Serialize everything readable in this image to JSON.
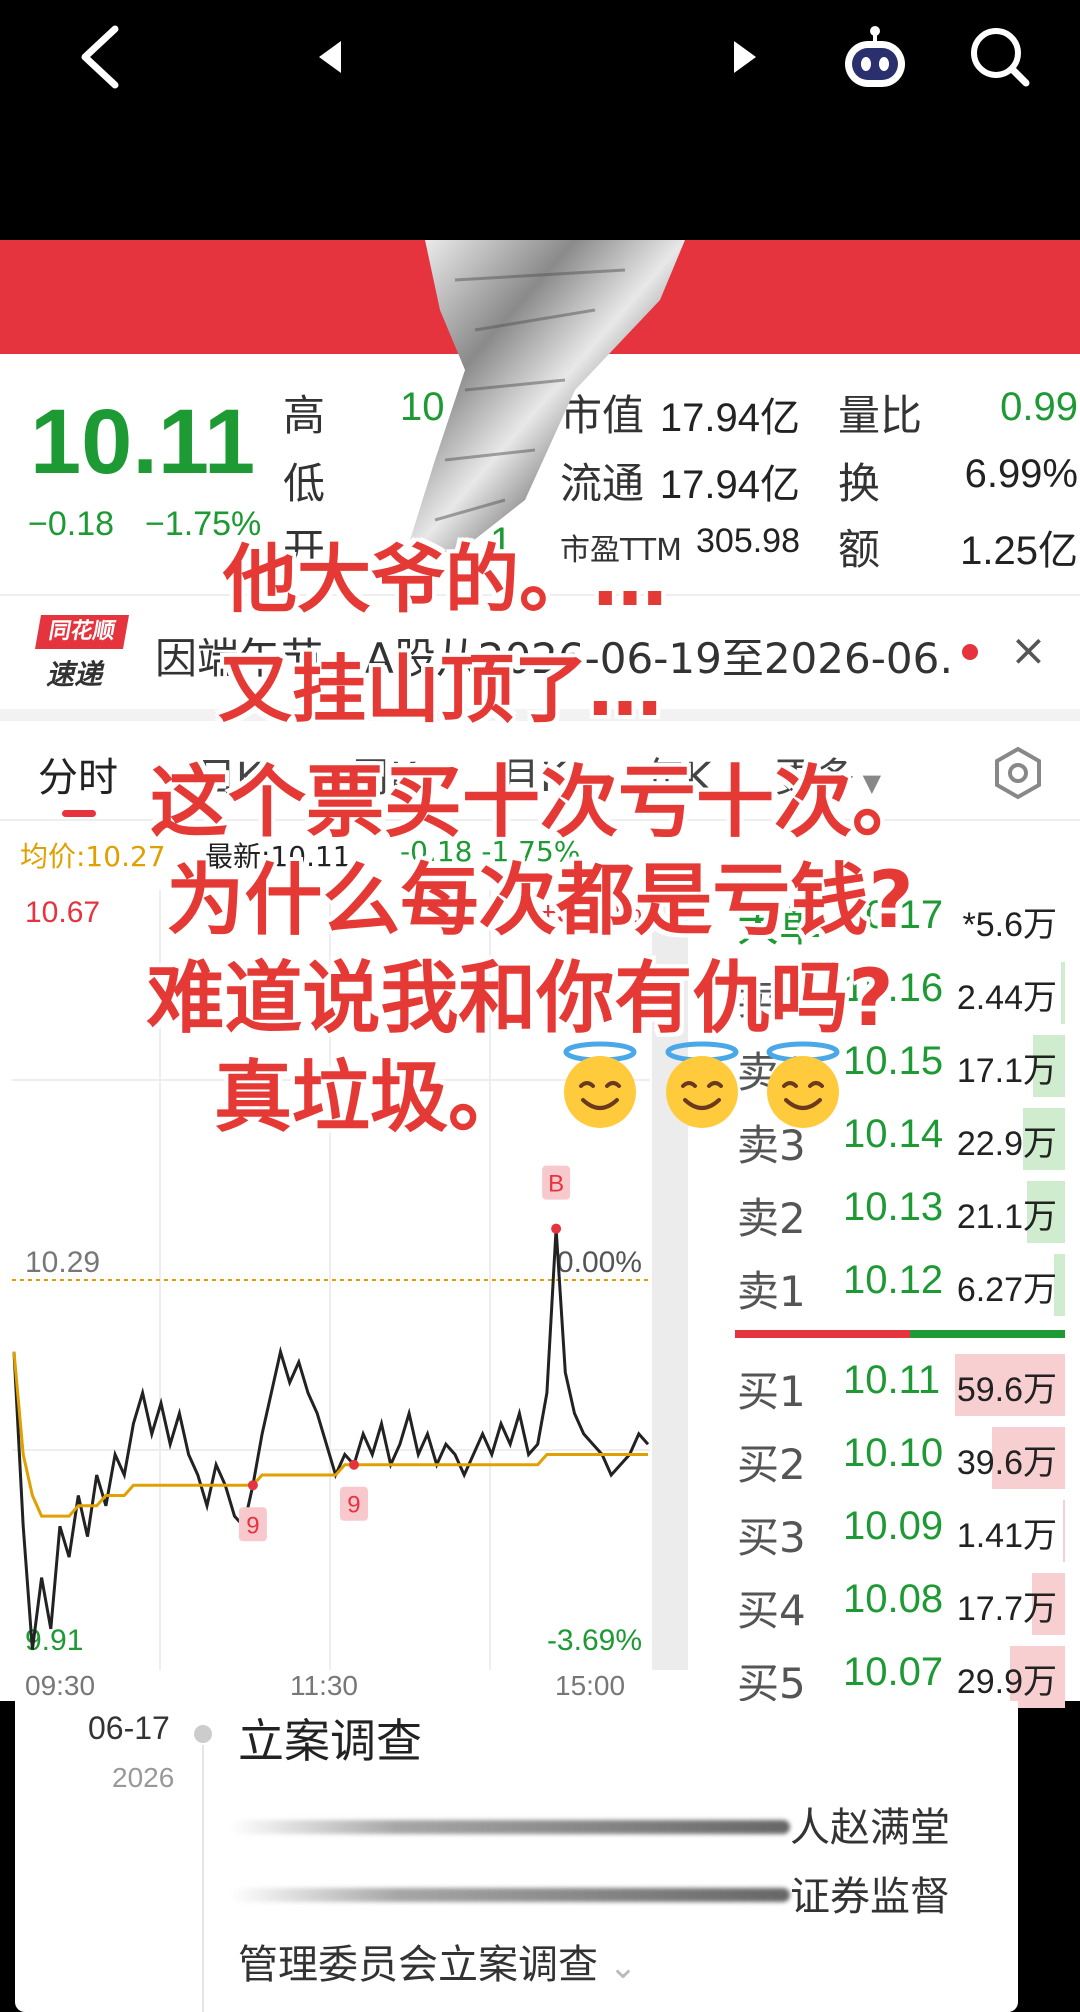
{
  "header": {
    "back_icon": "back-arrow-icon",
    "prev_icon": "prev-arrow-icon",
    "next_icon": "next-arrow-icon",
    "assistant_icon": "robot-icon",
    "search_icon": "search-icon",
    "bar_color": "#e5343e"
  },
  "quote": {
    "price": "10.11",
    "change": "−0.18",
    "change_pct": "−1.75%",
    "color": "#1d9a33",
    "stats": [
      {
        "label": "高",
        "value": "10"
      },
      {
        "label": "低",
        "value": ""
      },
      {
        "label": "开",
        "value": "1"
      },
      {
        "label": "市值",
        "value": "17.94亿"
      },
      {
        "label": "流通",
        "value": "17.94亿"
      },
      {
        "label": "市盈TTM",
        "value": "305.98"
      },
      {
        "label": "量比",
        "value": "0.99"
      },
      {
        "label": "换",
        "value": "6.99%"
      },
      {
        "label": "额",
        "value": "1.25亿"
      }
    ]
  },
  "news": {
    "logo_top": "同花顺",
    "logo_bottom": "速递",
    "text": "因端午节，A股从2026-06-19至2026-06…",
    "close": "×"
  },
  "tabs": {
    "items": [
      "分时",
      "日K",
      "周K",
      "月K",
      "年K",
      "更多"
    ],
    "active": "分时"
  },
  "chart_legend": {
    "avg": "均价:10.27",
    "latest": "最新:10.11",
    "chg": "-0.18  -1.75%"
  },
  "chart_data": {
    "type": "line",
    "y_high": "10.67",
    "y_prev_close": "10.29",
    "y_low": "9.91",
    "pct_high": "+3.69%",
    "pct_mid": "0.00%",
    "pct_low": "-3.69%",
    "x_ticks": [
      "09:30",
      "11:30",
      "15:00"
    ],
    "ylim": [
      9.91,
      10.67
    ],
    "prev_close": 10.29,
    "markers": [
      "9",
      "9",
      "B"
    ],
    "series": [
      {
        "values": [
          10.22,
          10.05,
          9.93,
          10.0,
          9.95,
          10.05,
          10.02,
          10.08,
          10.04,
          10.1,
          10.07,
          10.12,
          10.1,
          10.15,
          10.18,
          10.14,
          10.17,
          10.13,
          10.16,
          10.12,
          10.1,
          10.07,
          10.11,
          10.09,
          10.06,
          10.05,
          10.09,
          10.14,
          10.18,
          10.22,
          10.19,
          10.21,
          10.18,
          10.16,
          10.13,
          10.1,
          10.12,
          10.11,
          10.14,
          10.12,
          10.15,
          10.11,
          10.13,
          10.16,
          10.12,
          10.14,
          10.11,
          10.13,
          10.12,
          10.1,
          10.12,
          10.14,
          10.12,
          10.15,
          10.13,
          10.16,
          10.12,
          10.13,
          10.18,
          10.34,
          10.2,
          10.16,
          10.14,
          10.13,
          10.12,
          10.1,
          10.11,
          10.12,
          10.14,
          10.13
        ]
      },
      {
        "values": [
          10.22,
          10.12,
          10.08,
          10.06,
          10.06,
          10.06,
          10.06,
          10.07,
          10.07,
          10.07,
          10.08,
          10.08,
          10.08,
          10.09,
          10.09,
          10.09,
          10.09,
          10.09,
          10.09,
          10.09,
          10.09,
          10.09,
          10.09,
          10.09,
          10.09,
          10.09,
          10.09,
          10.1,
          10.1,
          10.1,
          10.1,
          10.1,
          10.1,
          10.1,
          10.1,
          10.1,
          10.11,
          10.11,
          10.11,
          10.11,
          10.11,
          10.11,
          10.11,
          10.11,
          10.11,
          10.11,
          10.11,
          10.11,
          10.11,
          10.11,
          10.11,
          10.11,
          10.11,
          10.11,
          10.11,
          10.11,
          10.11,
          10.11,
          10.12,
          10.12,
          10.12,
          10.12,
          10.12,
          10.12,
          10.12,
          10.12,
          10.12,
          10.12,
          10.12,
          10.12
        ]
      }
    ]
  },
  "order_book": {
    "sell": [
      {
        "label": "大单",
        "price": "10.17",
        "vol": "*5.6万",
        "fill": 0.0
      },
      {
        "label": "卖5",
        "price": "10.16",
        "vol": "2.44万",
        "fill": 0.04
      },
      {
        "label": "卖4",
        "price": "10.15",
        "vol": "17.1万",
        "fill": 0.29
      },
      {
        "label": "卖3",
        "price": "10.14",
        "vol": "22.9万",
        "fill": 0.38
      },
      {
        "label": "卖2",
        "price": "10.13",
        "vol": "21.1万",
        "fill": 0.35
      },
      {
        "label": "卖1",
        "price": "10.12",
        "vol": "6.27万",
        "fill": 0.1
      }
    ],
    "buy": [
      {
        "label": "买1",
        "price": "10.11",
        "vol": "59.6万",
        "fill": 1.0
      },
      {
        "label": "买2",
        "price": "10.10",
        "vol": "39.6万",
        "fill": 0.66
      },
      {
        "label": "买3",
        "price": "10.09",
        "vol": "1.41万",
        "fill": 0.02
      },
      {
        "label": "买4",
        "price": "10.08",
        "vol": "17.7万",
        "fill": 0.3
      },
      {
        "label": "买5",
        "price": "10.07",
        "vol": "29.9万",
        "fill": 0.5
      }
    ]
  },
  "timeline": {
    "date": "06-17",
    "year": "2026",
    "title": "立案调查",
    "line1": "人赵满堂",
    "line2": "证券监督",
    "line3": "管理委员会立案调查"
  },
  "overlay": {
    "lines": [
      "他大爷的。…",
      "又挂山顶了…",
      "这个票买十次亏十次。",
      "为什么每次都是亏钱?",
      "难道说我和你有仇吗?",
      "真垃圾。"
    ],
    "emoji_icon": "smiling-face-with-halo-icon",
    "color": "#e53935"
  }
}
